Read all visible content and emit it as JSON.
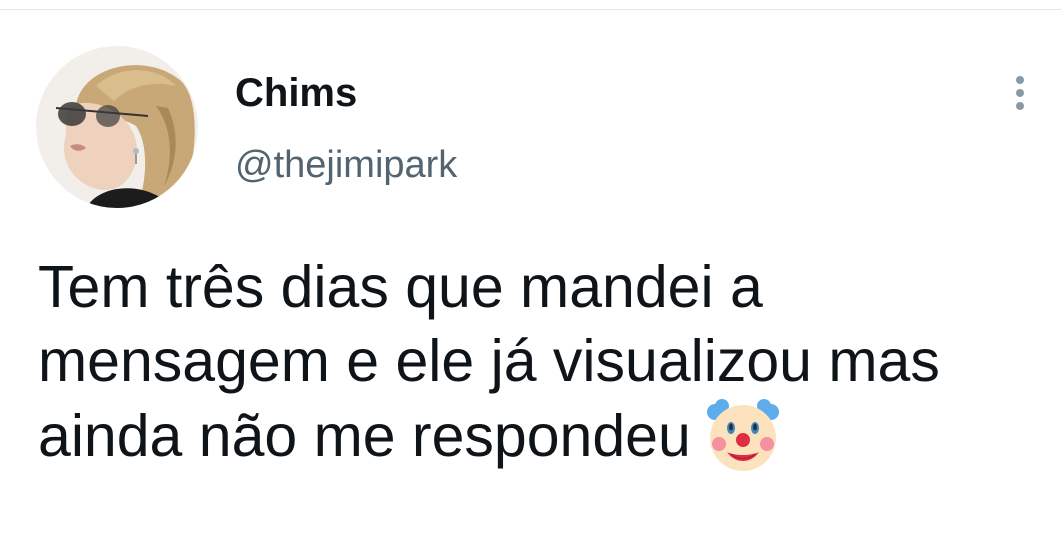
{
  "tweet": {
    "author": {
      "display_name": "Chims",
      "handle": "@thejimipark",
      "avatar_icon": "profile-photo"
    },
    "menu_icon": "more-vertical-icon",
    "text_lines": [
      "Tem três dias que mandei a",
      "mensagem e ele já visualizou mas",
      "ainda não me respondeu"
    ],
    "emoji": "clown-face-emoji"
  },
  "colors": {
    "text_primary": "#0f1419",
    "text_secondary": "#536471",
    "menu_dots": "#8899a6",
    "divider": "#e3e6e8"
  }
}
